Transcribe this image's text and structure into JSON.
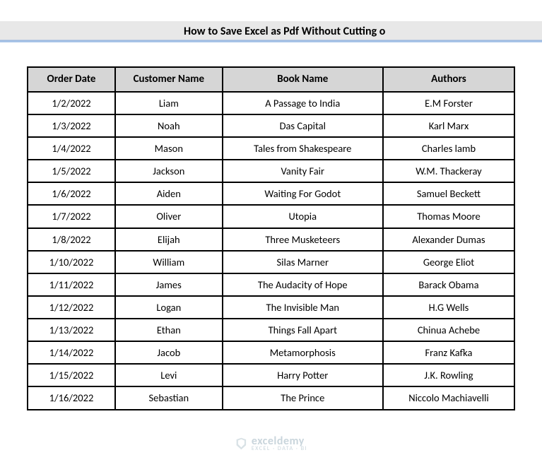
{
  "title": "How to Save Excel as Pdf Without Cutting o",
  "headers": [
    "Order Date",
    "Customer Name",
    "Book Name",
    "Authors"
  ],
  "rows": [
    [
      "1/2/2022",
      "Liam",
      "A Passage to India",
      "E.M Forster"
    ],
    [
      "1/3/2022",
      "Noah",
      "Das Capital",
      "Karl Marx"
    ],
    [
      "1/4/2022",
      "Mason",
      "Tales from Shakespeare",
      "Charles lamb"
    ],
    [
      "1/5/2022",
      "Jackson",
      "Vanity Fair",
      "W.M. Thackeray"
    ],
    [
      "1/6/2022",
      "Aiden",
      "Waiting For Godot",
      "Samuel Beckett"
    ],
    [
      "1/7/2022",
      "Oliver",
      "Utopia",
      "Thomas Moore"
    ],
    [
      "1/8/2022",
      "Elijah",
      "Three Musketeers",
      "Alexander Dumas"
    ],
    [
      "1/10/2022",
      "William",
      "Silas Marner",
      "George Eliot"
    ],
    [
      "1/11/2022",
      "James",
      "The Audacity of Hope",
      "Barack Obama"
    ],
    [
      "1/12/2022",
      "Logan",
      "The Invisible Man",
      "H.G Wells"
    ],
    [
      "1/13/2022",
      "Ethan",
      "Things Fall Apart",
      "Chinua Achebe"
    ],
    [
      "1/14/2022",
      "Jacob",
      "Metamorphosis",
      "Franz Kafka"
    ],
    [
      "1/15/2022",
      "Levi",
      "Harry Potter",
      "J.K. Rowling"
    ],
    [
      "1/16/2022",
      "Sebastian",
      "The Prince",
      "Niccolo Machiavelli"
    ]
  ],
  "watermark": {
    "brand": "exceldemy",
    "sub": "EXCEL · DATA · BI"
  }
}
